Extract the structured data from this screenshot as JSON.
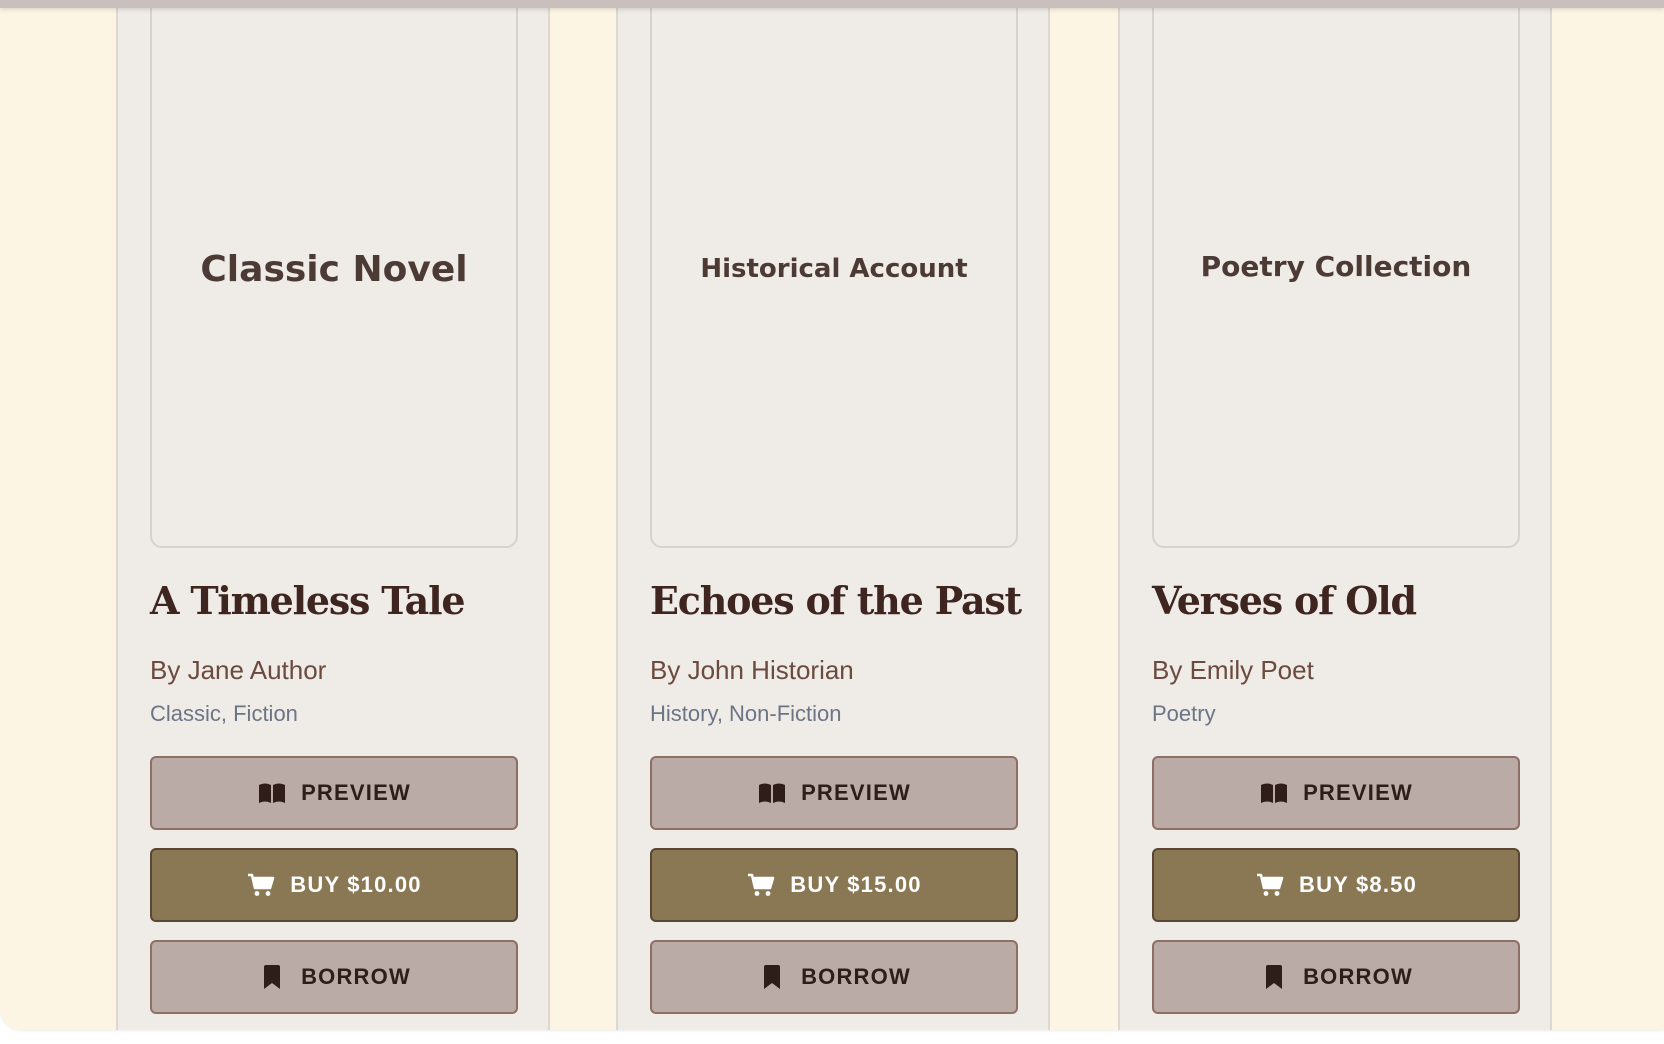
{
  "colors": {
    "page_background": "#fcf5e3",
    "card_background": "#efebe7",
    "title_color": "#3e2520",
    "author_color": "#6b4a3f",
    "genre_color": "#6c7585",
    "secondary_button": "#baaba6",
    "buy_button": "#8a7855"
  },
  "icons": {
    "preview": "open-book-icon",
    "buy": "shopping-cart-icon",
    "borrow": "bookmark-icon"
  },
  "books": [
    {
      "cover_label": "Classic Novel",
      "title": "A Timeless Tale",
      "author": "By Jane Author",
      "genres": "Classic, Fiction",
      "preview_label": "PREVIEW",
      "buy_label": "BUY $10.00",
      "borrow_label": "BORROW"
    },
    {
      "cover_label": "Historical Account",
      "title": "Echoes of the Past",
      "author": "By John Historian",
      "genres": "History, Non-Fiction",
      "preview_label": "PREVIEW",
      "buy_label": "BUY $15.00",
      "borrow_label": "BORROW"
    },
    {
      "cover_label": "Poetry Collection",
      "title": "Verses of Old",
      "author": "By Emily Poet",
      "genres": "Poetry",
      "preview_label": "PREVIEW",
      "buy_label": "BUY $8.50",
      "borrow_label": "BORROW"
    }
  ]
}
